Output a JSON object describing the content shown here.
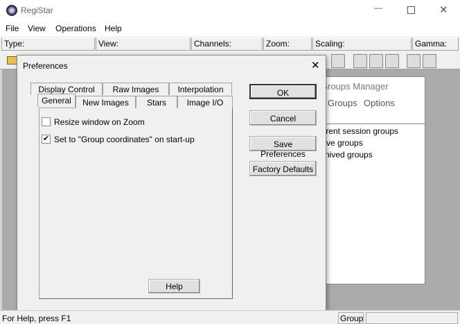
{
  "app": {
    "title": "RegiStar",
    "menu": [
      "File",
      "View",
      "Operations",
      "Help"
    ]
  },
  "info_fields": [
    "Type:",
    "View:",
    "Channels:",
    "Zoom:",
    "Scaling:",
    "Gamma:"
  ],
  "groups_manager": {
    "title": "Groups Manager",
    "menu": [
      "Groups",
      "Options"
    ],
    "items": [
      "Current session groups",
      "Active groups",
      "Archived groups"
    ]
  },
  "dialog": {
    "title": "Preferences",
    "tabs_back": [
      "Display Control",
      "Raw Images",
      "Interpolation"
    ],
    "tabs_front": [
      "General",
      "New Images",
      "Stars",
      "Image I/O"
    ],
    "active_tab": "General",
    "options": [
      {
        "label": "Resize window on Zoom",
        "checked": false
      },
      {
        "label": "Set to \"Group coordinates\" on start-up",
        "checked": true
      }
    ],
    "buttons": {
      "ok": "OK",
      "cancel": "Cancel",
      "save": "Save Preferences",
      "factory": "Factory Defaults",
      "help": "Help"
    }
  },
  "statusbar": {
    "text": "For Help, press F1",
    "mode": "Group"
  }
}
